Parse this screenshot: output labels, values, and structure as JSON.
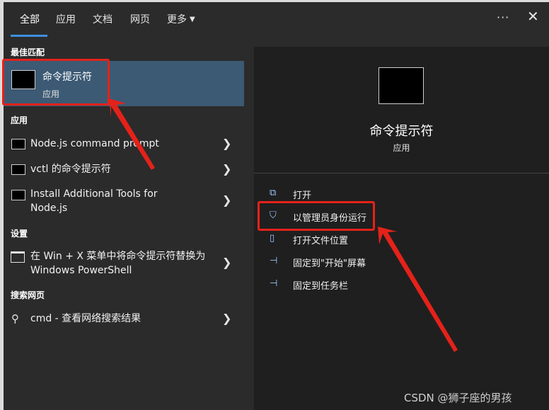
{
  "tabs": [
    {
      "label": "全部"
    },
    {
      "label": "应用"
    },
    {
      "label": "文档"
    },
    {
      "label": "网页"
    },
    {
      "label": "更多"
    }
  ],
  "window": {
    "more_options": "···",
    "close": "✕"
  },
  "sections": {
    "best_match": "最佳匹配",
    "apps": "应用",
    "settings": "设置",
    "web": "搜索网页"
  },
  "best_match": {
    "name": "命令提示符",
    "type": "应用"
  },
  "apps": [
    {
      "label": "Node.js command prompt"
    },
    {
      "label": "vctl 的命令提示符"
    },
    {
      "label": "Install Additional Tools for Node.js"
    }
  ],
  "settings": [
    {
      "label": "在 Win + X 菜单中将命令提示符替换为 Windows PowerShell"
    }
  ],
  "web": {
    "label": "cmd - 查看网络搜索结果"
  },
  "preview": {
    "title": "命令提示符",
    "subtitle": "应用",
    "actions": [
      {
        "label": "打开",
        "icon": "open-icon"
      },
      {
        "label": "以管理员身份运行",
        "icon": "shield-icon"
      },
      {
        "label": "打开文件位置",
        "icon": "file-icon"
      },
      {
        "label": "固定到\"开始\"屏幕",
        "icon": "pin-icon"
      },
      {
        "label": "固定到任务栏",
        "icon": "pin-icon"
      }
    ]
  },
  "watermark": "CSDN @狮子座的男孩",
  "colors": {
    "accent": "#3d8fe0",
    "selected": "#3c5a74",
    "annotation": "#e4221a"
  }
}
